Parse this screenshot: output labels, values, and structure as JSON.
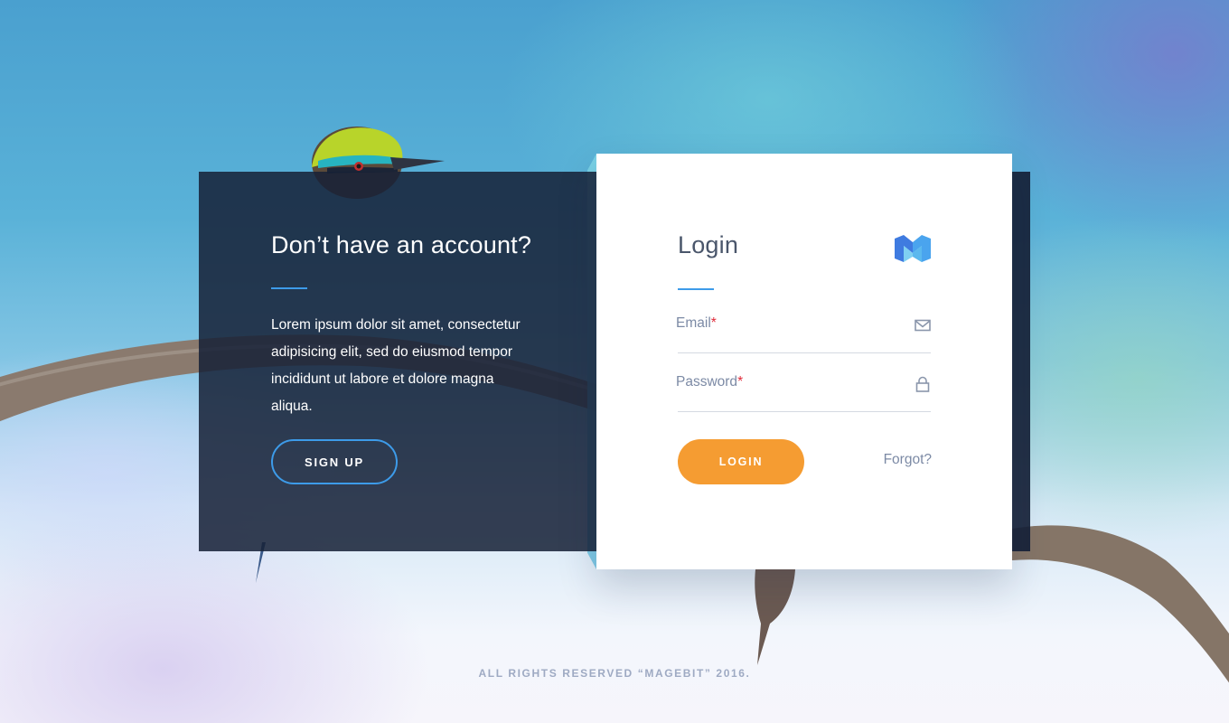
{
  "signup_panel": {
    "title": "Don’t have an account?",
    "body": "Lorem ipsum dolor sit amet, consectetur adipisicing elit, sed do eiusmod tempor incididunt ut labore et dolore magna aliqua.",
    "signup_label": "SIGN UP"
  },
  "login_panel": {
    "title": "Login",
    "logo_icon": "magebit-m-logo-icon",
    "email_label": "Email",
    "email_required_mark": "*",
    "email_value": "",
    "email_icon": "envelope-icon",
    "password_label": "Password",
    "password_required_mark": "*",
    "password_value": "",
    "password_icon": "padlock-icon",
    "login_label": "LOGIN",
    "forgot_label": "Forgot?"
  },
  "footer": {
    "copyright": "ALL RIGHTS RESERVED “MAGEBIT” 2016."
  },
  "colors": {
    "accent_blue": "#3d9be9",
    "login_orange": "#f59c32",
    "dark_panel": "#162137",
    "required_red": "#e02b3a",
    "muted_text": "#7c8aa5"
  }
}
